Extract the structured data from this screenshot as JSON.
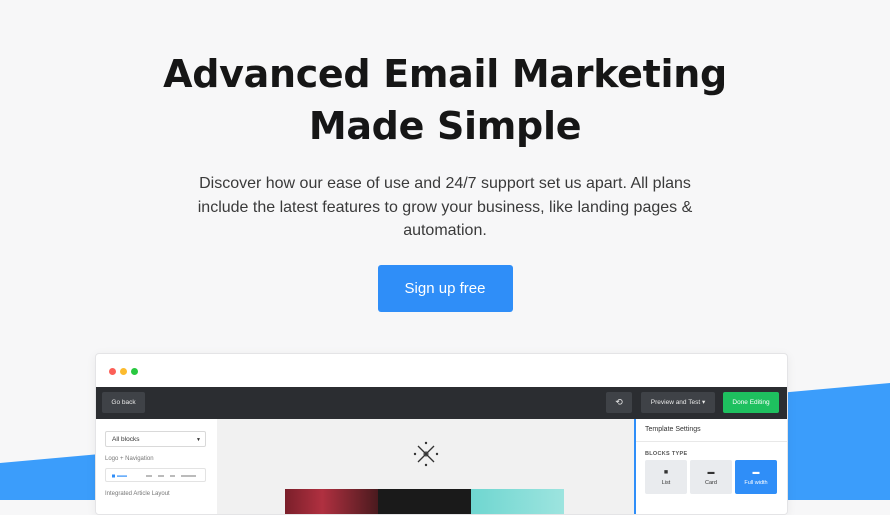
{
  "hero": {
    "title_line1": "Advanced Email Marketing",
    "title_line2": "Made Simple",
    "description": "Discover how our ease of use and 24/7 support set us apart. All plans include the latest features to grow your business, like landing pages & automation.",
    "cta_label": "Sign up free"
  },
  "editor": {
    "toolbar": {
      "go_back": "Go back",
      "history_icon": "history-icon",
      "preview_label": "Preview and Test",
      "done_label": "Done Editing"
    },
    "left_panel": {
      "select_value": "All blocks",
      "block_label_1": "Logo + Navigation",
      "block_label_2": "Integrated Article Layout"
    },
    "right_panel": {
      "title": "Template Settings",
      "blocks_type_label": "BLOCKS TYPE",
      "types": [
        {
          "label": "List",
          "icon": "list-icon"
        },
        {
          "label": "Card",
          "icon": "card-icon"
        },
        {
          "label": "Full width",
          "icon": "full-width-icon"
        }
      ],
      "selected_type": "Full width"
    }
  },
  "colors": {
    "accent": "#2f8ef8",
    "done_green": "#1ec05f",
    "toolbar_dark": "#2b2d31"
  }
}
